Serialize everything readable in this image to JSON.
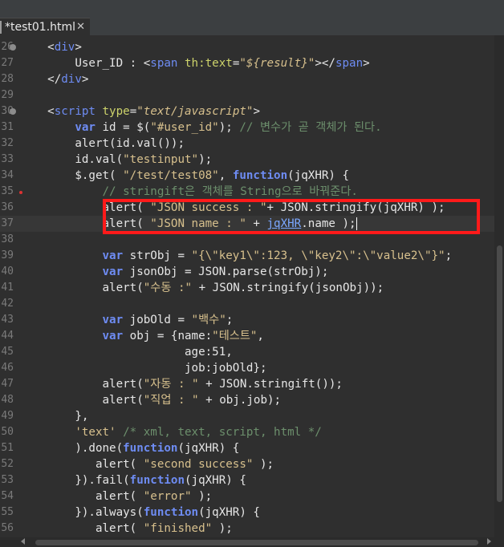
{
  "tab": {
    "title": "*test01.html",
    "close": "✕"
  },
  "lines": [
    {
      "n": "26",
      "fold": true,
      "segs": [
        [
          "    ",
          ""
        ],
        [
          "<",
          ""
        ],
        [
          "div",
          "tag"
        ],
        [
          ">",
          ""
        ]
      ]
    },
    {
      "n": "27",
      "segs": [
        [
          "        User_ID : ",
          ""
        ],
        [
          "<",
          ""
        ],
        [
          "span",
          "tag"
        ],
        [
          " ",
          ""
        ],
        [
          "th:text",
          "attr"
        ],
        [
          "=",
          ""
        ],
        [
          "\"${result}\"",
          "str ital"
        ],
        [
          "></",
          ""
        ],
        [
          "span",
          "tag"
        ],
        [
          ">",
          ""
        ]
      ]
    },
    {
      "n": "28",
      "segs": [
        [
          "    </",
          ""
        ],
        [
          "div",
          "tag"
        ],
        [
          ">",
          ""
        ]
      ]
    },
    {
      "n": "29",
      "segs": []
    },
    {
      "n": "30",
      "fold": true,
      "segs": [
        [
          "    <",
          ""
        ],
        [
          "script",
          "tag"
        ],
        [
          " ",
          ""
        ],
        [
          "type",
          "attr"
        ],
        [
          "=",
          ""
        ],
        [
          "\"text/javascript\"",
          "str ital"
        ],
        [
          ">",
          ""
        ]
      ]
    },
    {
      "n": "31",
      "segs": [
        [
          "        ",
          ""
        ],
        [
          "var",
          "kw"
        ],
        [
          " id = $(",
          ""
        ],
        [
          "\"#user_id\"",
          "str"
        ],
        [
          "); ",
          ""
        ],
        [
          "// 변수가 곧 객체가 된다.",
          "cmt"
        ]
      ]
    },
    {
      "n": "32",
      "segs": [
        [
          "        alert(id.val());",
          ""
        ]
      ]
    },
    {
      "n": "33",
      "segs": [
        [
          "        id.val(",
          ""
        ],
        [
          "\"testinput\"",
          "str"
        ],
        [
          ");",
          ""
        ]
      ]
    },
    {
      "n": "34",
      "segs": [
        [
          "        $.get( ",
          ""
        ],
        [
          "\"/test/test08\"",
          "str"
        ],
        [
          ", ",
          ""
        ],
        [
          "function",
          "kw"
        ],
        [
          "(jqXHR) {",
          ""
        ]
      ]
    },
    {
      "n": "35",
      "marker": true,
      "segs": [
        [
          "            ",
          ""
        ],
        [
          "// stringift은 객체를 String으로 바꿔준다.",
          "cmt"
        ]
      ]
    },
    {
      "n": "36",
      "segs": [
        [
          "            alert( ",
          ""
        ],
        [
          "\"JSON success : \"",
          "str"
        ],
        [
          "+ JSON.stringify(jqXHR) );",
          ""
        ]
      ]
    },
    {
      "n": "37",
      "cur": true,
      "segs": [
        [
          "            alert( ",
          ""
        ],
        [
          "\"JSON name : \"",
          "str"
        ],
        [
          " + ",
          ""
        ],
        [
          "jqXHR",
          "lnk"
        ],
        [
          ".name );",
          ""
        ]
      ]
    },
    {
      "n": "38",
      "segs": []
    },
    {
      "n": "39",
      "segs": [
        [
          "            ",
          ""
        ],
        [
          "var",
          "kw"
        ],
        [
          " strObj = ",
          ""
        ],
        [
          "\"{\\\"key1\\\":123, \\\"key2\\\":\\\"value2\\\"}\"",
          "str"
        ],
        [
          ";",
          ""
        ]
      ]
    },
    {
      "n": "40",
      "segs": [
        [
          "            ",
          ""
        ],
        [
          "var",
          "kw"
        ],
        [
          " jsonObj = JSON.parse(strObj);",
          ""
        ]
      ]
    },
    {
      "n": "41",
      "segs": [
        [
          "            alert(",
          ""
        ],
        [
          "\"수동 :\"",
          "str"
        ],
        [
          " + JSON.stringify(jsonObj));",
          ""
        ]
      ]
    },
    {
      "n": "42",
      "segs": []
    },
    {
      "n": "43",
      "segs": [
        [
          "            ",
          ""
        ],
        [
          "var",
          "kw"
        ],
        [
          " jobOld = ",
          ""
        ],
        [
          "\"백수\"",
          "str"
        ],
        [
          ";",
          ""
        ]
      ]
    },
    {
      "n": "44",
      "segs": [
        [
          "            ",
          ""
        ],
        [
          "var",
          "kw"
        ],
        [
          " obj = {name:",
          ""
        ],
        [
          "\"테스트\"",
          "str"
        ],
        [
          ",",
          ""
        ]
      ]
    },
    {
      "n": "45",
      "segs": [
        [
          "                        age:51,",
          ""
        ]
      ]
    },
    {
      "n": "46",
      "segs": [
        [
          "                        job:jobOld};",
          ""
        ]
      ]
    },
    {
      "n": "47",
      "segs": [
        [
          "            alert(",
          ""
        ],
        [
          "\"자동 : \"",
          "str"
        ],
        [
          " + JSON.stringift());",
          ""
        ]
      ]
    },
    {
      "n": "48",
      "segs": [
        [
          "            alert(",
          ""
        ],
        [
          "\"직업 : \"",
          "str"
        ],
        [
          " + obj.job);",
          ""
        ]
      ]
    },
    {
      "n": "49",
      "segs": [
        [
          "        },",
          ""
        ]
      ]
    },
    {
      "n": "50",
      "segs": [
        [
          "        ",
          ""
        ],
        [
          "'text'",
          "str"
        ],
        [
          " ",
          ""
        ],
        [
          "/* xml, text, script, html */",
          "cmt"
        ]
      ]
    },
    {
      "n": "51",
      "segs": [
        [
          "        ).done(",
          ""
        ],
        [
          "function",
          "kw"
        ],
        [
          "(jqXHR) {",
          ""
        ]
      ]
    },
    {
      "n": "52",
      "segs": [
        [
          "           alert( ",
          ""
        ],
        [
          "\"second success\"",
          "str"
        ],
        [
          " );",
          ""
        ]
      ]
    },
    {
      "n": "53",
      "segs": [
        [
          "        }).fail(",
          ""
        ],
        [
          "function",
          "kw"
        ],
        [
          "(jqXHR) {",
          ""
        ]
      ]
    },
    {
      "n": "54",
      "segs": [
        [
          "           alert( ",
          ""
        ],
        [
          "\"error\"",
          "str"
        ],
        [
          " );",
          ""
        ]
      ]
    },
    {
      "n": "55",
      "segs": [
        [
          "        }).always(",
          ""
        ],
        [
          "function",
          "kw"
        ],
        [
          "(jqXHR) {",
          ""
        ]
      ]
    },
    {
      "n": "56",
      "segs": [
        [
          "           alert( ",
          ""
        ],
        [
          "\"finished\"",
          "str"
        ],
        [
          " );",
          ""
        ]
      ]
    }
  ]
}
